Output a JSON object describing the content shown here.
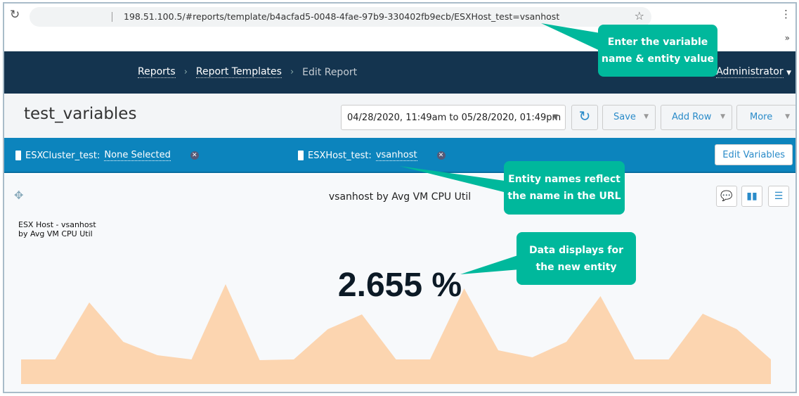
{
  "browser": {
    "url": "198.51.100.5/#reports/template/b4acfad5-0048-4fae-97b9-330402fb9ecb/ESXHost_test=vsanhost",
    "extensions_label": "»"
  },
  "nav": {
    "breadcrumbs": [
      "Reports",
      "Report Templates",
      "Edit Report"
    ],
    "user": "Administrator"
  },
  "header": {
    "title": "test_variables",
    "date_range": "04/28/2020, 11:49am to 05/28/2020, 01:49pm",
    "save": "Save",
    "add_row": "Add Row",
    "more": "More"
  },
  "variables": [
    {
      "name": "ESXCluster_test:",
      "value": "None Selected"
    },
    {
      "name": "ESXHost_test:",
      "value": "vsanhost"
    }
  ],
  "edit_variables": "Edit Variables",
  "widget": {
    "title": "vsanhost by Avg VM CPU Util",
    "subtitle_line1": "ESX Host - vsanhost",
    "subtitle_line2": "by Avg VM CPU Util",
    "value": "2.655 %",
    "sparkline_color": "#fcd5b0",
    "sparkline_values": [
      35,
      35,
      116,
      60,
      41,
      35,
      142,
      34,
      35,
      78,
      99,
      35,
      35,
      136,
      48,
      38,
      60,
      125,
      35,
      35,
      100,
      78,
      35
    ]
  },
  "callouts": {
    "url": [
      "Enter the variable",
      "name & entity value"
    ],
    "entity": [
      "Entity names reflect",
      "the name in the URL"
    ],
    "data": [
      "Data displays for",
      "the new entity"
    ],
    "color": "#00b89c"
  }
}
